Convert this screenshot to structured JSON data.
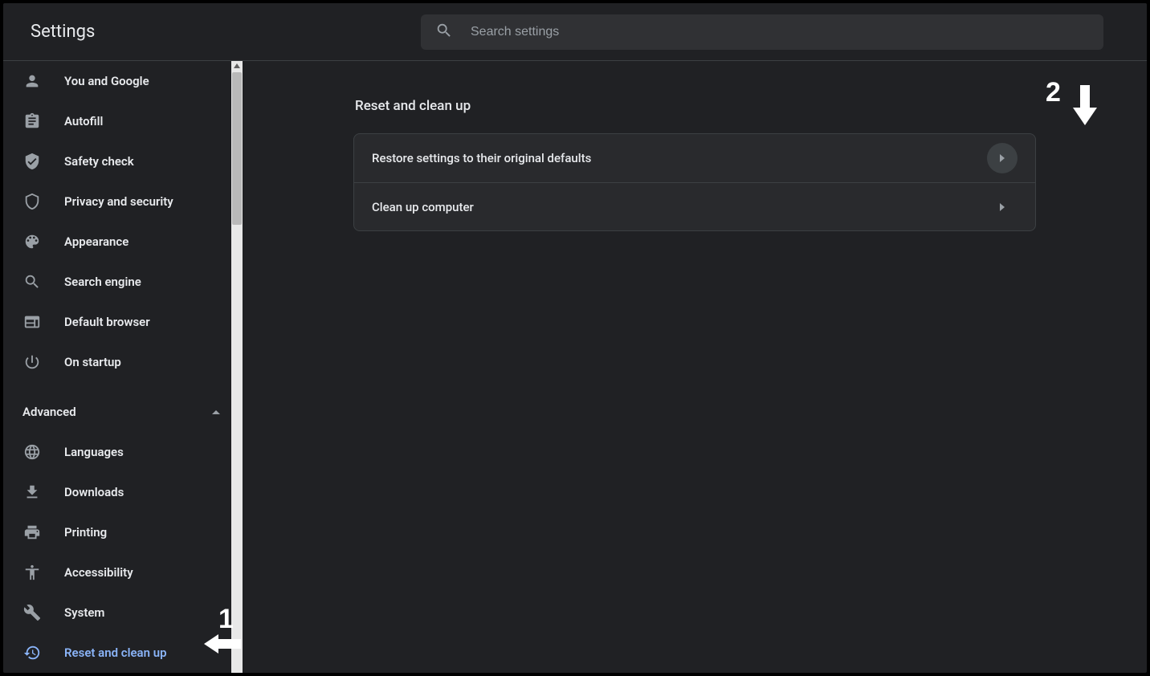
{
  "header": {
    "title": "Settings",
    "search_placeholder": "Search settings"
  },
  "sidebar": {
    "items": [
      {
        "id": "you-and-google",
        "label": "You and Google",
        "icon": "person"
      },
      {
        "id": "autofill",
        "label": "Autofill",
        "icon": "clipboard"
      },
      {
        "id": "safety-check",
        "label": "Safety check",
        "icon": "shield-check"
      },
      {
        "id": "privacy-and-security",
        "label": "Privacy and security",
        "icon": "shield"
      },
      {
        "id": "appearance",
        "label": "Appearance",
        "icon": "palette"
      },
      {
        "id": "search-engine",
        "label": "Search engine",
        "icon": "search"
      },
      {
        "id": "default-browser",
        "label": "Default browser",
        "icon": "browser"
      },
      {
        "id": "on-startup",
        "label": "On startup",
        "icon": "power"
      }
    ],
    "advanced_label": "Advanced",
    "advanced_items": [
      {
        "id": "languages",
        "label": "Languages",
        "icon": "globe"
      },
      {
        "id": "downloads",
        "label": "Downloads",
        "icon": "download"
      },
      {
        "id": "printing",
        "label": "Printing",
        "icon": "printer"
      },
      {
        "id": "accessibility",
        "label": "Accessibility",
        "icon": "accessibility"
      },
      {
        "id": "system",
        "label": "System",
        "icon": "wrench"
      },
      {
        "id": "reset-and-clean-up",
        "label": "Reset and clean up",
        "icon": "restore",
        "active": true
      }
    ]
  },
  "main": {
    "section_title": "Reset and clean up",
    "rows": [
      {
        "id": "restore-defaults",
        "label": "Restore settings to their original defaults",
        "highlight": true
      },
      {
        "id": "clean-up-computer",
        "label": "Clean up computer",
        "highlight": false
      }
    ]
  },
  "annotations": {
    "one": "1",
    "two": "2"
  }
}
